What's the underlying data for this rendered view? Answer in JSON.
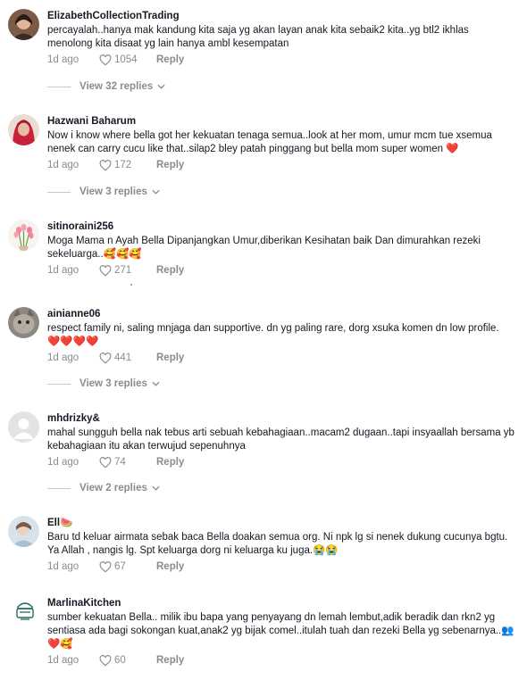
{
  "comments": [
    {
      "username": "ElizabethCollectionTrading",
      "text": "percayalah..hanya mak kandung kita saja yg akan layan anak kita sebaik2 kita..yg btl2 ikhlas menolong kita disaat yg lain hanya ambl kesempatan",
      "age": "1d ago",
      "likes": "1054",
      "reply": "Reply",
      "view_replies": "View 32 replies"
    },
    {
      "username": "Hazwani Baharum",
      "text": "Now i know where bella got her kekuatan tenaga semua..look at her mom, umur mcm tue xsemua nenek can carry cucu like that..silap2 bley patah pinggang but bella mom super women ❤️",
      "age": "1d ago",
      "likes": "172",
      "reply": "Reply",
      "view_replies": "View 3 replies"
    },
    {
      "username": "sitinoraini256",
      "text": "Moga Mama n Ayah Bella Dipanjangkan Umur,diberikan Kesihatan baik Dan dimurahkan rezeki sekeluarga..🥰🥰🥰",
      "age": "1d ago",
      "likes": "271",
      "reply": "Reply"
    },
    {
      "username": "ainianne06",
      "text": "respect family ni, saling mnjaga dan supportive. dn yg paling rare, dorg xsuka komen dn low profile. ❤️❤️❤️❤️",
      "age": "1d ago",
      "likes": "441",
      "reply": "Reply",
      "view_replies": "View 3 replies"
    },
    {
      "username": "mhdrizky&",
      "text": "mahal sungguh bella nak tebus arti sebuah kebahagiaan..macam2 dugaan..tapi insyaallah bersama yb kebahagiaan itu akan terwujud sepenuhnya",
      "age": "1d ago",
      "likes": "74",
      "reply": "Reply",
      "view_replies": "View 2 replies"
    },
    {
      "username": "Ell🍉",
      "text": "Baru td keluar airmata sebak baca Bella doakan semua org. Ni npk lg si nenek dukung cucunya bgtu. Ya Allah , nangis lg. Spt keluarga dorg ni keluarga ku juga.😭😭",
      "age": "1d ago",
      "likes": "67",
      "reply": "Reply"
    },
    {
      "username": "MarlinaKitchen",
      "text": "sumber kekuatan Bella.. milik ibu bapa yang penyayang dn lemah lembut,adik beradik dan rkn2 yg sentiasa ada bagi sokongan kuat,anak2 yg bijak comel..itulah tuah dan rezeki Bella yg sebenarnya..👥❤️🥰",
      "age": "1d ago",
      "likes": "60",
      "reply": "Reply"
    }
  ],
  "icons": {
    "like": "heart-outline-icon",
    "chevron": "chevron-down-icon",
    "avatar_default": "default-avatar-icon"
  },
  "colors": {
    "text": "#161823",
    "muted": "#8a8b91"
  }
}
